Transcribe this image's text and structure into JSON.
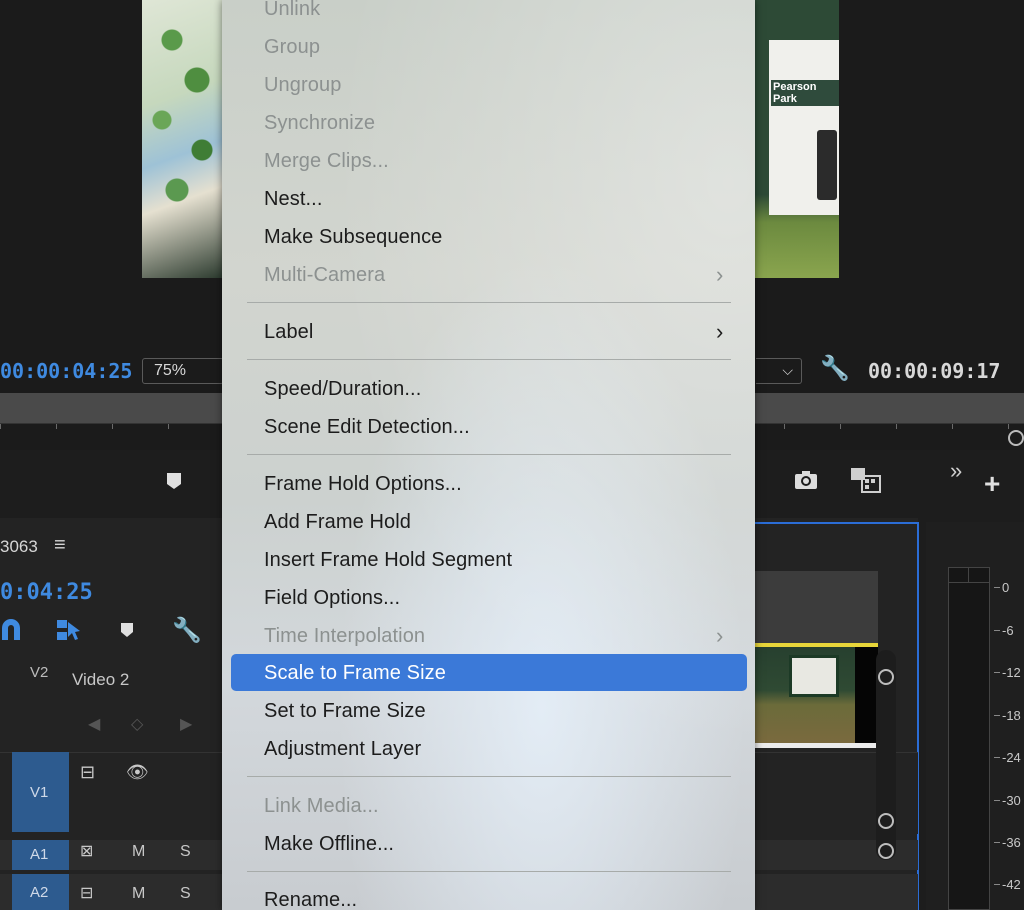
{
  "program_monitor": {
    "timecode_current": "00:00:04:25",
    "zoom": "75%",
    "timecode_duration": "00:00:09:17",
    "preview_sign_title": "Pearson Park"
  },
  "timeline": {
    "sequence_name": "3063",
    "timecode": "0:04:25",
    "tracks": {
      "v2": {
        "label": "V2",
        "name": "Video 2"
      },
      "v1": {
        "label": "V1"
      },
      "a1": {
        "label": "A1",
        "mute": "M",
        "solo": "S"
      },
      "a2": {
        "label": "A2",
        "mute": "M",
        "solo": "S"
      }
    }
  },
  "audio_meter": {
    "db_labels": [
      "0",
      "-6",
      "-12",
      "-18",
      "-24",
      "-30",
      "-36",
      "-42"
    ]
  },
  "context_menu": {
    "items": [
      {
        "label": "Unlink",
        "enabled": false
      },
      {
        "label": "Group",
        "enabled": false
      },
      {
        "label": "Ungroup",
        "enabled": false
      },
      {
        "label": "Synchronize",
        "enabled": false
      },
      {
        "label": "Merge Clips...",
        "enabled": false
      },
      {
        "label": "Nest...",
        "enabled": true
      },
      {
        "label": "Make Subsequence",
        "enabled": true
      },
      {
        "label": "Multi-Camera",
        "enabled": false,
        "submenu": true
      },
      {
        "label": "Label",
        "enabled": true,
        "submenu": true
      },
      {
        "label": "Speed/Duration...",
        "enabled": true
      },
      {
        "label": "Scene Edit Detection...",
        "enabled": true
      },
      {
        "label": "Frame Hold Options...",
        "enabled": true
      },
      {
        "label": "Add Frame Hold",
        "enabled": true
      },
      {
        "label": "Insert Frame Hold Segment",
        "enabled": true
      },
      {
        "label": "Field Options...",
        "enabled": true
      },
      {
        "label": "Time Interpolation",
        "enabled": false,
        "submenu": true
      },
      {
        "label": "Scale to Frame Size",
        "enabled": true,
        "highlighted": true
      },
      {
        "label": "Set to Frame Size",
        "enabled": true
      },
      {
        "label": "Adjustment Layer",
        "enabled": true
      },
      {
        "label": "Link Media...",
        "enabled": false
      },
      {
        "label": "Make Offline...",
        "enabled": true
      },
      {
        "label": "Rename...",
        "enabled": true
      }
    ],
    "highlight_color": "#3b79d8"
  },
  "colors": {
    "timecode_blue": "#3f8ae0",
    "track_target_blue": "#2d5b8f",
    "panel_focus_blue": "#2b6dd6"
  }
}
